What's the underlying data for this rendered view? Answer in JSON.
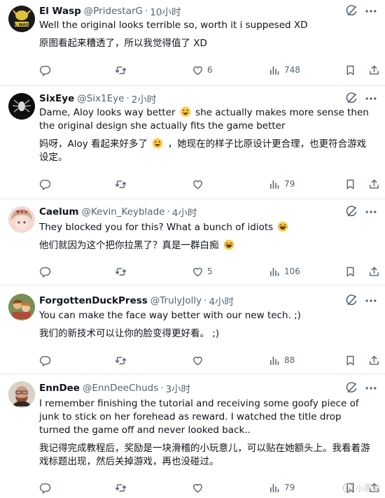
{
  "tweets": [
    {
      "name": "El Wasp",
      "handle": "@PridestarG",
      "dot": "·",
      "time": "10小时",
      "text_en": "Well the original looks terrible so, worth it i suppesed XD",
      "text_zh": "原图看起来糟透了，所以我觉得值了 XD",
      "replies": "",
      "retweets": "",
      "likes": "6",
      "views": "748",
      "avatar_text": "EL WASP"
    },
    {
      "name": "SixEye",
      "handle": "@Six1Eye",
      "dot": "·",
      "time": "2小时",
      "text_en_a": "Dame, Aloy looks way better",
      "text_en_b": "she actually makes more sense then the original design she actually fits the game better",
      "text_zh_a": "妈呀，Aloy 看起来好多了",
      "text_zh_b": "，她现在的样子比原设计更合理，也更符合游戏设定。",
      "replies": "",
      "retweets": "",
      "likes": "",
      "views": "79"
    },
    {
      "name": "Caelum",
      "handle": "@Kevin_Keyblade",
      "dot": "·",
      "time": "4小时",
      "text_en": "They blocked you for this? What a bunch of idiots",
      "text_zh": "他们就因为这个把你拉黑了？真是一群白痴",
      "replies": "",
      "retweets": "",
      "likes": "5",
      "views": "106"
    },
    {
      "name": "ForgottenDuckPress",
      "handle": "@TrulyJolly",
      "dot": "·",
      "time": "4小时",
      "text_en": "You can make the face way better with our new tech. ;)",
      "text_zh": "我们的新技术可以让你的脸变得更好看。 ;)",
      "replies": "",
      "retweets": "",
      "likes": "",
      "views": "88"
    },
    {
      "name": "EnnDee",
      "handle": "@EnnDeeChuds",
      "dot": "·",
      "time": "3小时",
      "text_en": "I remember finishing the tutorial and receiving some goofy piece of junk to stick on her forehead as reward. I watched the title drop turned the game off and never looked back..",
      "text_zh": "我记得完成教程后，奖励是一块滑稽的小玩意儿，可以贴在她额头上。我看着游戏标题出现，然后关掉游戏，再也没碰过。",
      "replies": "",
      "retweets": "",
      "likes": "",
      "views": "79"
    }
  ],
  "watermark": "小黑盒",
  "colors": {
    "text": "#0f1419",
    "secondary": "#536471",
    "divider": "#e5e8eb"
  }
}
